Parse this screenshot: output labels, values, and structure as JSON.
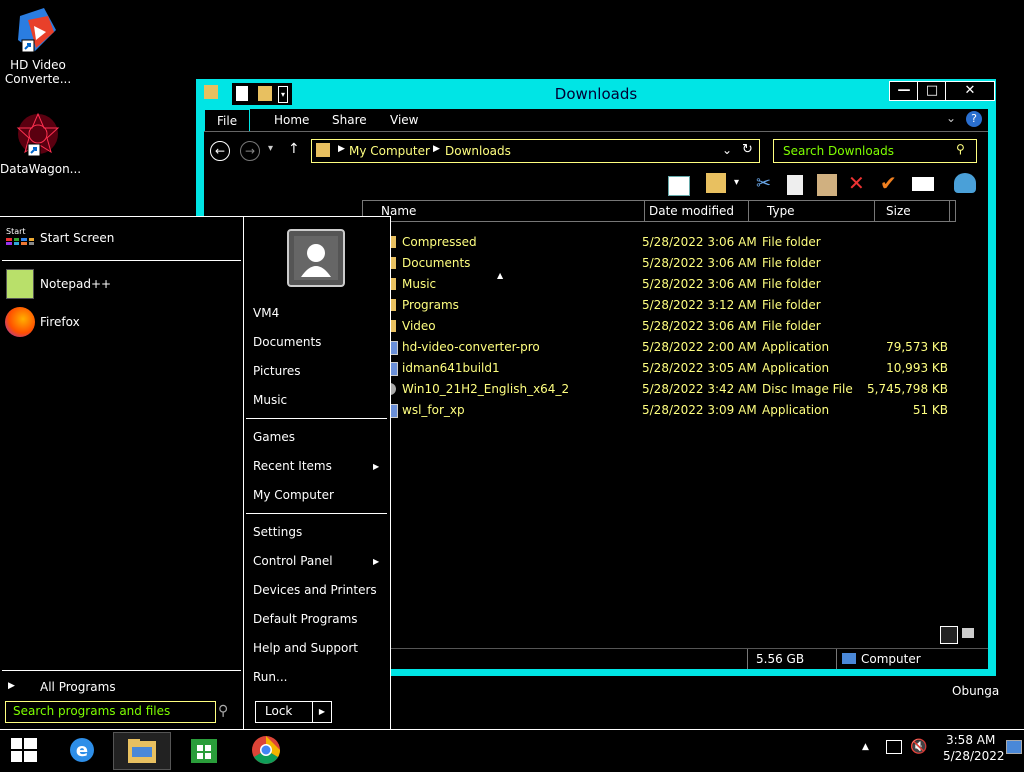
{
  "desktop": {
    "icons": [
      {
        "label": "HD Video Converte..."
      },
      {
        "label": "DataWagon..."
      }
    ],
    "user_label": "Obunga"
  },
  "explorer": {
    "title": "Downloads",
    "ribbon_tabs": [
      "File",
      "Home",
      "Share",
      "View"
    ],
    "breadcrumb": [
      "My Computer",
      "Downloads"
    ],
    "search_placeholder": "Search Downloads",
    "columns": [
      "Name",
      "Date modified",
      "Type",
      "Size"
    ],
    "files": [
      {
        "name": "Compressed",
        "date": "5/28/2022 3:06 AM",
        "type": "File folder",
        "size": "",
        "icon": "folder-icon"
      },
      {
        "name": "Documents",
        "date": "5/28/2022 3:06 AM",
        "type": "File folder",
        "size": "",
        "icon": "folder-icon"
      },
      {
        "name": "Music",
        "date": "5/28/2022 3:06 AM",
        "type": "File folder",
        "size": "",
        "icon": "folder-icon"
      },
      {
        "name": "Programs",
        "date": "5/28/2022 3:12 AM",
        "type": "File folder",
        "size": "",
        "icon": "folder-icon"
      },
      {
        "name": "Video",
        "date": "5/28/2022 3:06 AM",
        "type": "File folder",
        "size": "",
        "icon": "folder-icon"
      },
      {
        "name": "hd-video-converter-pro",
        "date": "5/28/2022 2:00 AM",
        "type": "Application",
        "size": "79,573 KB",
        "icon": "app-icon"
      },
      {
        "name": "idman641build1",
        "date": "5/28/2022 3:05 AM",
        "type": "Application",
        "size": "10,993 KB",
        "icon": "app-icon"
      },
      {
        "name": "Win10_21H2_English_x64_2",
        "date": "5/28/2022 3:42 AM",
        "type": "Disc Image File",
        "size": "5,745,798 KB",
        "icon": "disc-image-icon"
      },
      {
        "name": "wsl_for_xp",
        "date": "5/28/2022 3:09 AM",
        "type": "Application",
        "size": "51 KB",
        "icon": "app-icon"
      }
    ],
    "status": {
      "size": "5.56 GB",
      "location": "Computer"
    }
  },
  "start_menu": {
    "pinned": [
      "Start Screen",
      "Notepad++",
      "Firefox"
    ],
    "start_tile_label": "Start",
    "all_programs": "All Programs",
    "search_placeholder": "Search programs and files",
    "right_group1": [
      "VM4",
      "Documents",
      "Pictures",
      "Music"
    ],
    "right_group2": [
      "Games",
      "Recent Items",
      "My Computer"
    ],
    "right_group3": [
      "Settings",
      "Control Panel",
      "Devices and Printers",
      "Default Programs",
      "Help and Support",
      "Run..."
    ],
    "lock_label": "Lock"
  },
  "taskbar": {
    "time": "3:58 AM",
    "date": "5/28/2022",
    "pinned": [
      "windows-logo-icon",
      "internet-explorer-icon",
      "file-explorer-icon",
      "store-icon",
      "chrome-icon"
    ]
  },
  "colors": {
    "accent": "#00e5e5",
    "text_yellow": "#ffff80",
    "search_green": "#7fff00"
  }
}
